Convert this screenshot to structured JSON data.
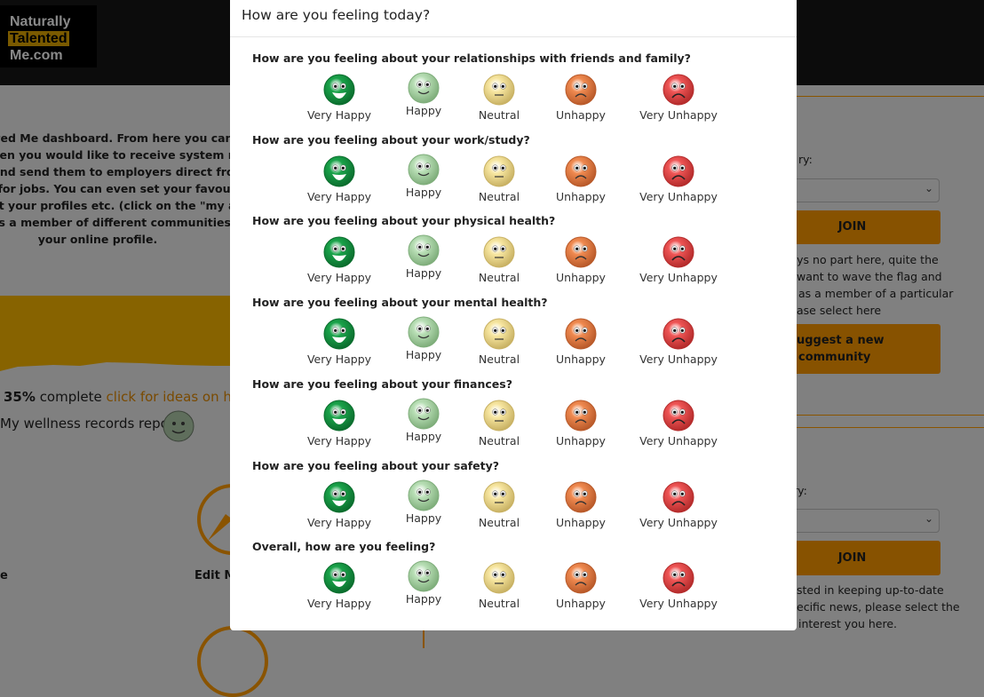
{
  "logo": {
    "line1": "Naturally",
    "line2": "Talented",
    "line3": "Me.com"
  },
  "background": {
    "intro_lines": [
      "Talented Me dashboard. From here you can",
      "ow/when you would like to receive system n",
      "ofile and send them to employers direct fro",
      "apply for jobs. You can even set your favour",
      "ughout your profiles etc. (click on the \"my a",
      "self as a member of different communities",
      "your online profile."
    ],
    "progress_percent": "35%",
    "progress_text": "complete",
    "progress_link": "click for ideas on how",
    "wellness_label": "My wellness records report",
    "tile_label_left": "e",
    "tile_label_edit": "Edit My",
    "community1": {
      "label": "ry:",
      "select_value": "...",
      "join": "JOIN",
      "text_lines": [
        "lays no part here, quite the",
        "want to wave the flag and",
        "as a member of a particular",
        "ase select here"
      ],
      "suggest_lines": [
        "uggest a new",
        "community"
      ]
    },
    "community2": {
      "label": "ry:",
      "select_value": "...",
      "join": "JOIN",
      "text_lines": [
        "sted in keeping up-to-date",
        "ecific news, please select the",
        "interest you here."
      ]
    }
  },
  "modal": {
    "title": "How are you feeling today?",
    "options": [
      {
        "label": "Very Happy",
        "icon": "very-happy-face-icon",
        "color": "#1aa34a"
      },
      {
        "label": "Happy",
        "icon": "happy-face-icon",
        "color": "#b9dfb6"
      },
      {
        "label": "Neutral",
        "icon": "neutral-face-icon",
        "color": "#f7e6a0"
      },
      {
        "label": "Unhappy",
        "icon": "unhappy-face-icon",
        "color": "#f08a50"
      },
      {
        "label": "Very Unhappy",
        "icon": "very-unhappy-face-icon",
        "color": "#ef5555"
      }
    ],
    "questions": [
      "How are you feeling about your relationships with friends and family?",
      "How are you feeling about your work/study?",
      "How are you feeling about your physical health?",
      "How are you feeling about your mental health?",
      "How are you feeling about your finances?",
      "How are you feeling about your safety?",
      "Overall, how are you feeling?"
    ]
  }
}
